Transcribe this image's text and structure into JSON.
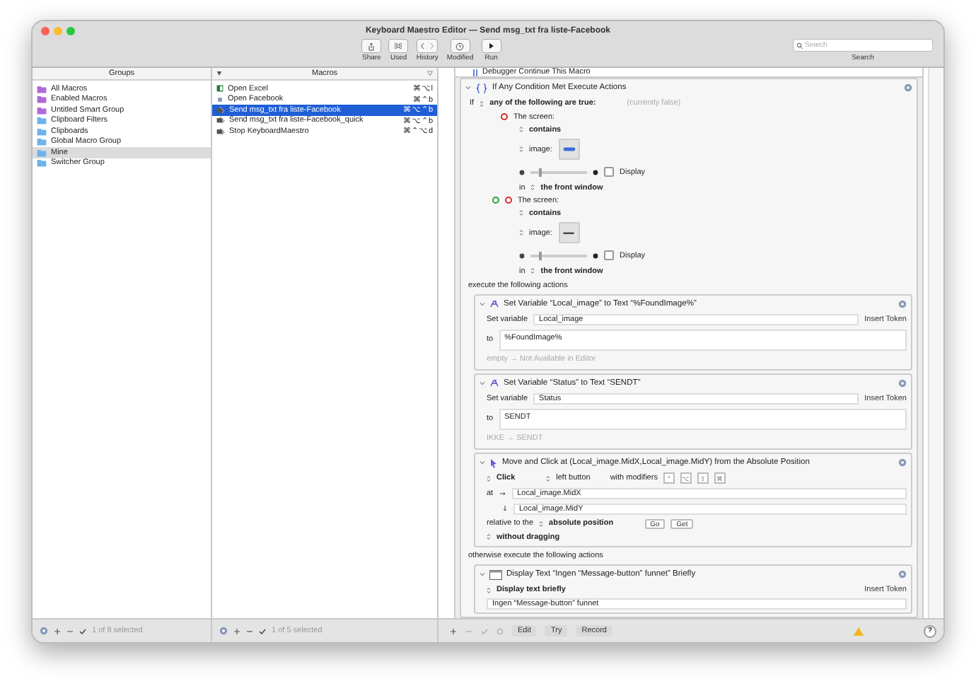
{
  "window": {
    "title": "Keyboard Maestro Editor — Send msg_txt fra liste-Facebook"
  },
  "toolbar": [
    {
      "kind": "share",
      "label": "Share"
    },
    {
      "kind": "used",
      "label": "Used"
    },
    {
      "kind": "history",
      "label": "History"
    },
    {
      "kind": "modified",
      "label": "Modified"
    },
    {
      "kind": "run",
      "label": "Run"
    }
  ],
  "search": {
    "placeholder": "Search",
    "label": "Search"
  },
  "groups": {
    "header": "Groups",
    "items": [
      {
        "name": "All Macros",
        "kind": "smart",
        "selected": false
      },
      {
        "name": "Enabled Macros",
        "kind": "smart",
        "selected": false
      },
      {
        "name": "Untitled Smart Group",
        "kind": "smart",
        "selected": false
      },
      {
        "name": "Clipboard Filters",
        "kind": "folder",
        "selected": false
      },
      {
        "name": "Clipboards",
        "kind": "folder",
        "selected": false
      },
      {
        "name": "Global Macro Group",
        "kind": "folder",
        "selected": false
      },
      {
        "name": "Mine",
        "kind": "folder",
        "selected": true
      },
      {
        "name": "Switcher Group",
        "kind": "folder",
        "selected": false
      }
    ],
    "footer": "1 of 8 selected"
  },
  "macros": {
    "header": "Macros",
    "items": [
      {
        "name": "Open Excel",
        "shortcut": "⌘⌥l",
        "kind": "excel",
        "selected": false
      },
      {
        "name": "Open Facebook",
        "shortcut": "⌘⌃b",
        "kind": "app",
        "selected": false
      },
      {
        "name": "Send msg_txt fra liste-Facebook",
        "shortcut": "⌘⌥⌃b",
        "kind": "km",
        "selected": true
      },
      {
        "name": "Send msg_txt fra liste-Facebook_quick",
        "shortcut": "⌘⌥⌃b",
        "kind": "km",
        "selected": false
      },
      {
        "name": "Stop KeyboardMaestro",
        "shortcut": "⌘⌃⌥d",
        "kind": "km",
        "selected": false
      }
    ],
    "footer": "1 of 5 selected"
  },
  "editor": {
    "top_action": "Debugger Continue This Macro",
    "if_block": {
      "title": "If Any Condition Met Execute Actions",
      "if_label": "If",
      "match": "any of the following are true:",
      "status": "(currently false)",
      "conditions": [
        {
          "label": "The screen:",
          "add_button": false,
          "op": "contains",
          "image_label": "image:",
          "thumbnail": {
            "kind": "bar"
          },
          "level": 0.15,
          "display": "Display",
          "checked": false,
          "in_label": "in",
          "window": "the front window"
        },
        {
          "label": "The screen:",
          "add_button": true,
          "op": "contains",
          "image_label": "image:",
          "thumbnail": {
            "kind": "label"
          },
          "level": 0.15,
          "display": "Display",
          "checked": false,
          "in_label": "in",
          "window": "the front window"
        }
      ],
      "then_label": "execute the following actions",
      "actions": [
        {
          "kind": "set_variable",
          "title": "Set Variable “Local_image” to Text “%FoundImage%”",
          "set_label": "Set variable",
          "variable": "Local_image",
          "insert_token": "Insert Token",
          "to_label": "to",
          "value": "%FoundImage%",
          "preview": "empty → Not Available in Editor"
        },
        {
          "kind": "set_variable",
          "title": "Set Variable “Status” to Text “SENDT”",
          "set_label": "Set variable",
          "variable": "Status",
          "insert_token": "Insert Token",
          "to_label": "to",
          "value": "SENDT",
          "preview": "IKKE → SENDT"
        },
        {
          "kind": "move_click",
          "title": "Move and Click at (Local_image.MidX,Local_image.MidY) from the Absolute Position",
          "click": "Click",
          "button": "left button",
          "with_modifiers": "with modifiers",
          "modifiers": [
            "⌃",
            "⌥",
            "⇧",
            "⌘"
          ],
          "at_label": "at",
          "x": "Local_image.MidX",
          "y": "Local_image.MidY",
          "relative_label": "relative to the",
          "relative": "absolute position",
          "go": "Go",
          "get": "Get",
          "drag": "without dragging"
        }
      ],
      "else_label": "otherwise execute the following actions",
      "else_actions": [
        {
          "kind": "display_text",
          "title": "Display Text “Ingen “Message-button” funnet” Briefly",
          "mode": "Display text briefly",
          "insert_token": "Insert Token",
          "text": "Ingen “Message-button” funnet"
        }
      ]
    }
  },
  "editor_footer": {
    "buttons": [
      "Edit",
      "Try",
      "Record"
    ],
    "help": "?"
  }
}
